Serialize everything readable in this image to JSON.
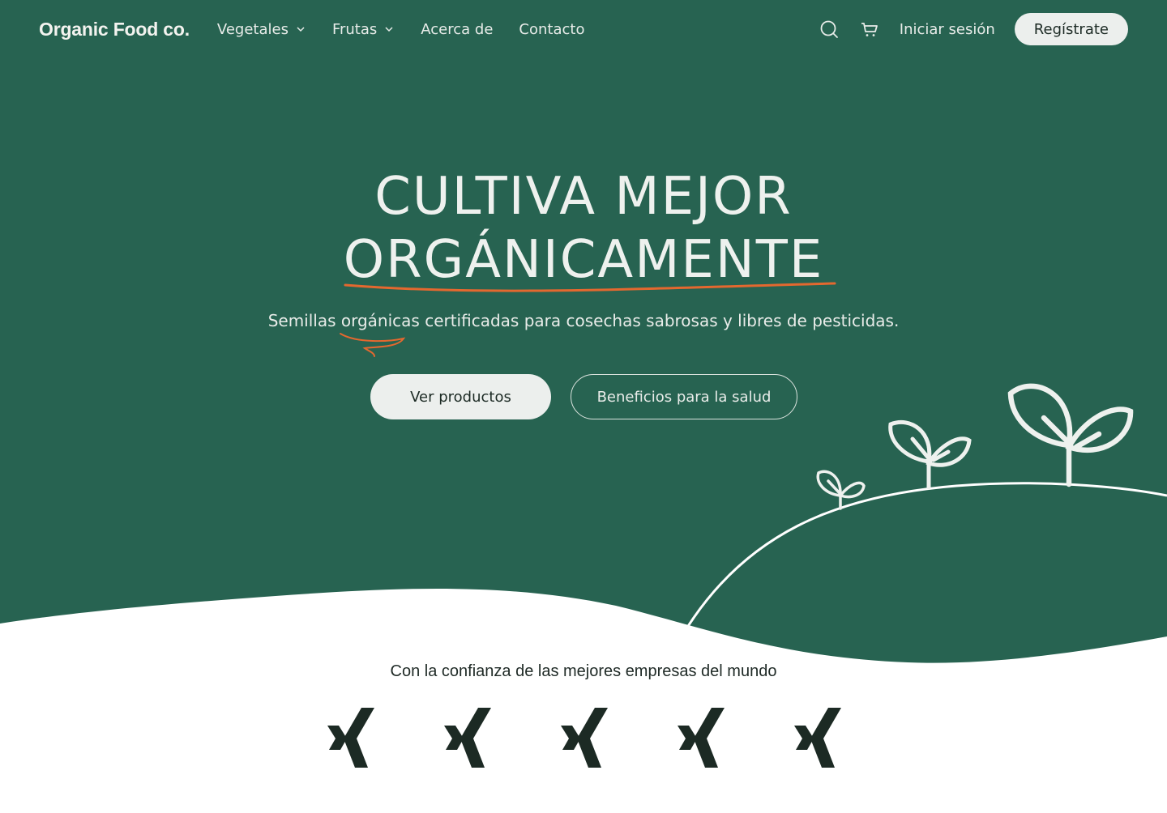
{
  "colors": {
    "hero_bg": "#276351",
    "accent": "#e4682f",
    "light": "#ecefed",
    "dark": "#1c2a24"
  },
  "nav": {
    "brand": "Organic Food co.",
    "items": [
      {
        "label": "Vegetales",
        "icon": "chevron-down-icon"
      },
      {
        "label": "Frutas",
        "icon": "chevron-down-icon"
      },
      {
        "label": "Acerca de"
      },
      {
        "label": "Contacto"
      }
    ],
    "search_icon": "search-icon",
    "cart_icon": "cart-icon",
    "login": "Iniciar sesión",
    "signup": "Regístrate"
  },
  "hero": {
    "headline_line1": "CULTIVA MEJOR",
    "headline_line2": "ORGÁNICAMENTE",
    "subtitle": "Semillas orgánicas certificadas para cosechas sabrosas y libres de pesticidas.",
    "primary_button": "Ver productos",
    "secondary_button": "Beneficios para la salud",
    "illustration": "sprouts-on-hill-illustration"
  },
  "trust": {
    "label": "Con la confianza de las mejores empresas del mundo",
    "logos": [
      "xing-logo",
      "xing-logo",
      "xing-logo",
      "xing-logo",
      "xing-logo"
    ]
  }
}
